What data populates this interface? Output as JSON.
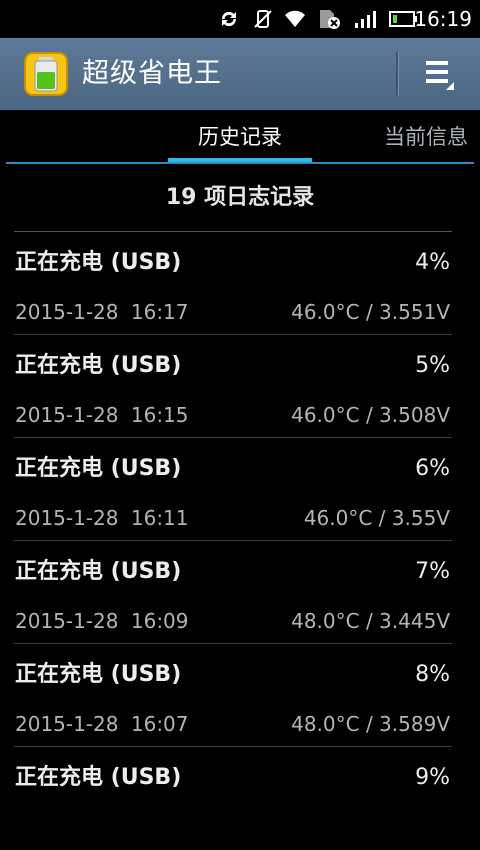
{
  "status_bar": {
    "time": "16:19",
    "icons": [
      "sync-icon",
      "vibrate-mute-icon",
      "wifi-icon",
      "sim-error-icon",
      "signal-icon",
      "battery-charging-icon"
    ],
    "accent": "#5fd34a"
  },
  "app_bar": {
    "title": "超级省电王",
    "background": "#4f6b88"
  },
  "tabs": [
    {
      "label": "历史记录",
      "active": true
    },
    {
      "label": "当前信息",
      "active": false
    }
  ],
  "tab_accent": "#33b5e5",
  "log_count_label": "19 项日志记录",
  "logs": [
    {
      "status": "正在充电 (USB)",
      "percent": "4%",
      "datetime": "2015-1-28 16:17",
      "reading": "46.0°C / 3.551V"
    },
    {
      "status": "正在充电 (USB)",
      "percent": "5%",
      "datetime": "2015-1-28 16:15",
      "reading": "46.0°C / 3.508V"
    },
    {
      "status": "正在充电 (USB)",
      "percent": "6%",
      "datetime": "2015-1-28 16:11",
      "reading": "46.0°C / 3.55V"
    },
    {
      "status": "正在充电 (USB)",
      "percent": "7%",
      "datetime": "2015-1-28 16:09",
      "reading": "48.0°C / 3.445V"
    },
    {
      "status": "正在充电 (USB)",
      "percent": "8%",
      "datetime": "2015-1-28 16:07",
      "reading": "48.0°C / 3.589V"
    },
    {
      "status": "正在充电 (USB)",
      "percent": "9%",
      "datetime": "",
      "reading": ""
    }
  ]
}
